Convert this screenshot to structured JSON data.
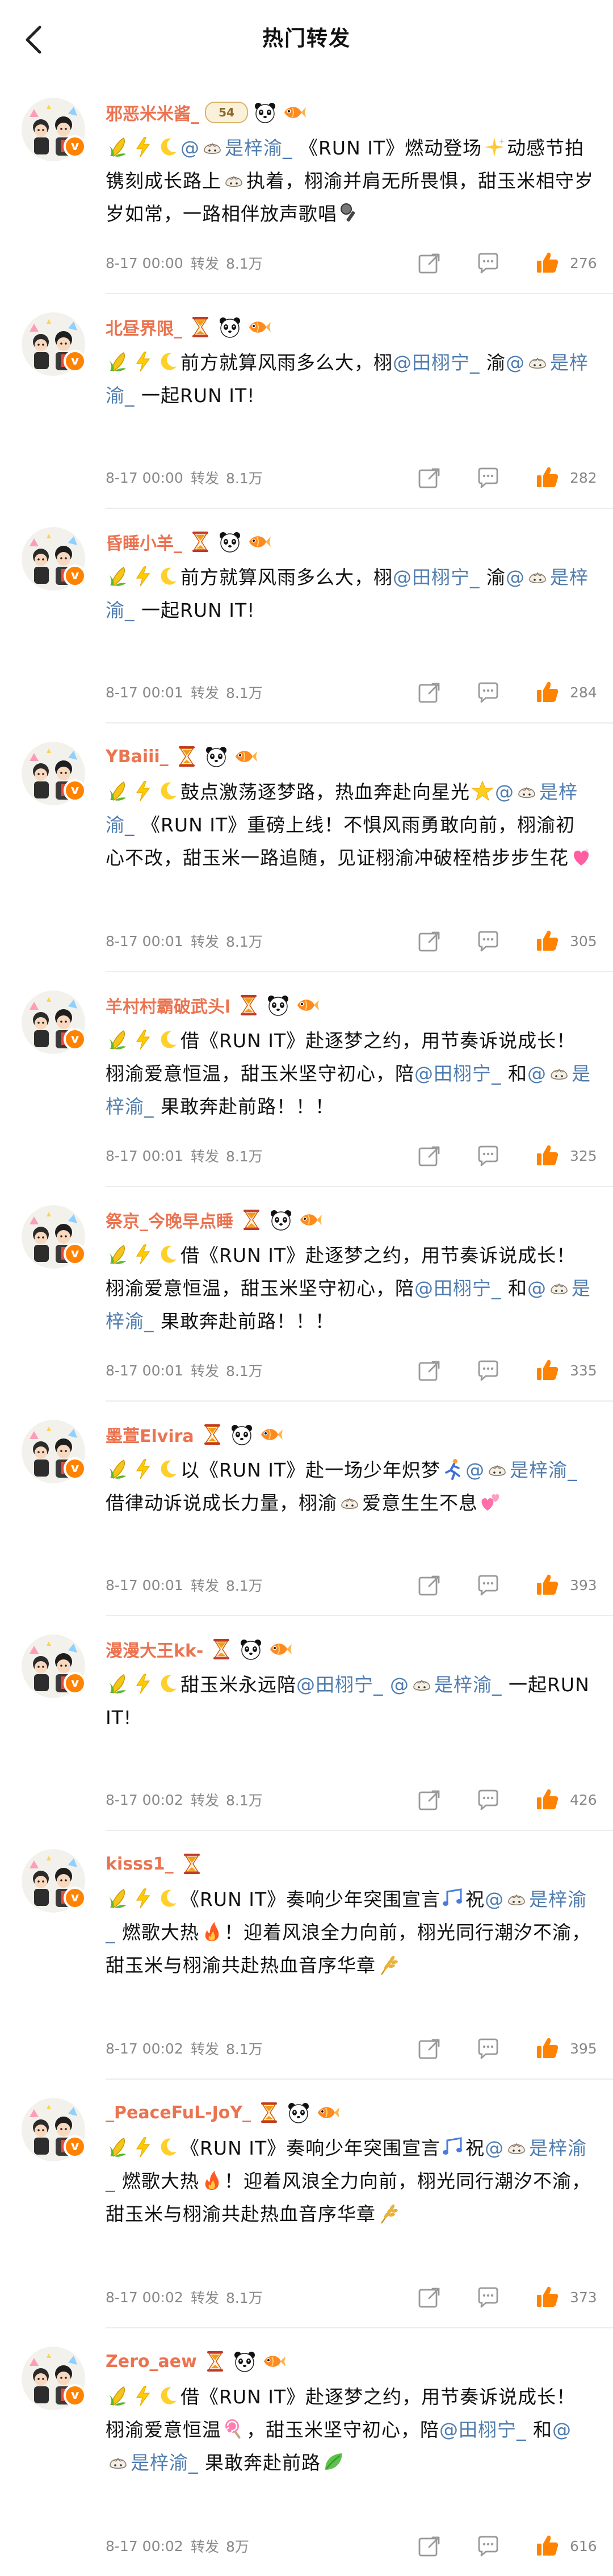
{
  "header": {
    "title": "热门转发"
  },
  "posts": [
    {
      "user": "邪恶米米酱_",
      "badge_tag": "54",
      "segments": [
        {
          "t": "emo",
          "k": "corn"
        },
        {
          "t": "emo",
          "k": "bolt"
        },
        {
          "t": "emo",
          "k": "moon"
        },
        {
          "t": "at",
          "v": "@"
        },
        {
          "t": "emo",
          "k": "dumpling"
        },
        {
          "t": "at",
          "v": "是梓渝_"
        },
        {
          "t": "text",
          "v": " 《RUN IT》燃动登场"
        },
        {
          "t": "emo",
          "k": "sparkle"
        },
        {
          "t": "text",
          "v": "动感节拍镌刻成长路上"
        },
        {
          "t": "emo",
          "k": "dumpling"
        },
        {
          "t": "text",
          "v": "执着，栩渝并肩无所畏惧，甜玉米相守岁岁如常，一路相伴放声歌唱"
        },
        {
          "t": "emo",
          "k": "mic"
        }
      ],
      "time": "8-17 00:00",
      "repost_label": "转发",
      "repost_count": "8.1万",
      "likes": "276"
    },
    {
      "user": "北昼界限_",
      "segments": [
        {
          "t": "emo",
          "k": "corn"
        },
        {
          "t": "emo",
          "k": "bolt"
        },
        {
          "t": "emo",
          "k": "moon"
        },
        {
          "t": "text",
          "v": "前方就算风雨多么大，栩"
        },
        {
          "t": "at",
          "v": "@田栩宁_"
        },
        {
          "t": "text",
          "v": " 渝"
        },
        {
          "t": "at",
          "v": "@"
        },
        {
          "t": "emo",
          "k": "dumpling"
        },
        {
          "t": "at",
          "v": "是梓渝_"
        },
        {
          "t": "text",
          "v": " 一起RUN IT!"
        }
      ],
      "time": "8-17 00:00",
      "repost_label": "转发",
      "repost_count": "8.1万",
      "likes": "282"
    },
    {
      "user": "昏睡小羊_",
      "segments": [
        {
          "t": "emo",
          "k": "corn"
        },
        {
          "t": "emo",
          "k": "bolt"
        },
        {
          "t": "emo",
          "k": "moon"
        },
        {
          "t": "text",
          "v": "前方就算风雨多么大，栩"
        },
        {
          "t": "at",
          "v": "@田栩宁_"
        },
        {
          "t": "text",
          "v": " 渝"
        },
        {
          "t": "at",
          "v": "@"
        },
        {
          "t": "emo",
          "k": "dumpling"
        },
        {
          "t": "at",
          "v": "是梓渝_"
        },
        {
          "t": "text",
          "v": " 一起RUN IT!"
        }
      ],
      "time": "8-17 00:01",
      "repost_label": "转发",
      "repost_count": "8.1万",
      "likes": "284"
    },
    {
      "user": "YBaiii_",
      "segments": [
        {
          "t": "emo",
          "k": "corn"
        },
        {
          "t": "emo",
          "k": "bolt"
        },
        {
          "t": "emo",
          "k": "moon"
        },
        {
          "t": "text",
          "v": "鼓点激荡逐梦路，热血奔赴向星光"
        },
        {
          "t": "emo",
          "k": "star"
        },
        {
          "t": "at",
          "v": "@"
        },
        {
          "t": "emo",
          "k": "dumpling"
        },
        {
          "t": "at",
          "v": "是梓渝_"
        },
        {
          "t": "text",
          "v": " 《RUN IT》重磅上线！不惧风雨勇敢向前，栩渝初心不改，甜玉米一路追随，见证栩渝冲破桎梏步步生花"
        },
        {
          "t": "emo",
          "k": "heart"
        }
      ],
      "time": "8-17 00:01",
      "repost_label": "转发",
      "repost_count": "8.1万",
      "likes": "305"
    },
    {
      "user": "羊村村霸破武头l",
      "segments": [
        {
          "t": "emo",
          "k": "corn"
        },
        {
          "t": "emo",
          "k": "bolt"
        },
        {
          "t": "emo",
          "k": "moon"
        },
        {
          "t": "text",
          "v": "借《RUN IT》赴逐梦之约，用节奏诉说成长！栩渝爱意恒温，甜玉米坚守初心，陪"
        },
        {
          "t": "at",
          "v": "@田栩宁_"
        },
        {
          "t": "text",
          "v": " 和"
        },
        {
          "t": "at",
          "v": "@"
        },
        {
          "t": "emo",
          "k": "dumpling"
        },
        {
          "t": "at",
          "v": "是梓渝_"
        },
        {
          "t": "text",
          "v": " 果敢奔赴前路！！！"
        }
      ],
      "time": "8-17 00:01",
      "repost_label": "转发",
      "repost_count": "8.1万",
      "likes": "325"
    },
    {
      "user": "祭京_今晚早点睡",
      "segments": [
        {
          "t": "emo",
          "k": "corn"
        },
        {
          "t": "emo",
          "k": "bolt"
        },
        {
          "t": "emo",
          "k": "moon"
        },
        {
          "t": "text",
          "v": "借《RUN IT》赴逐梦之约，用节奏诉说成长！栩渝爱意恒温，甜玉米坚守初心，陪"
        },
        {
          "t": "at",
          "v": "@田栩宁_"
        },
        {
          "t": "text",
          "v": " 和"
        },
        {
          "t": "at",
          "v": "@"
        },
        {
          "t": "emo",
          "k": "dumpling"
        },
        {
          "t": "at",
          "v": "是梓渝_"
        },
        {
          "t": "text",
          "v": " 果敢奔赴前路！！！"
        }
      ],
      "time": "8-17 00:01",
      "repost_label": "转发",
      "repost_count": "8.1万",
      "likes": "335"
    },
    {
      "user": "墨萱Elvira",
      "segments": [
        {
          "t": "emo",
          "k": "corn"
        },
        {
          "t": "emo",
          "k": "bolt"
        },
        {
          "t": "emo",
          "k": "moon"
        },
        {
          "t": "text",
          "v": "以《RUN IT》赴一场少年炽梦"
        },
        {
          "t": "emo",
          "k": "runner"
        },
        {
          "t": "at",
          "v": "@"
        },
        {
          "t": "emo",
          "k": "dumpling"
        },
        {
          "t": "at",
          "v": "是梓渝_"
        },
        {
          "t": "text",
          "v": " 借律动诉说成长力量，栩渝"
        },
        {
          "t": "emo",
          "k": "dumpling"
        },
        {
          "t": "text",
          "v": "爱意生生不息"
        },
        {
          "t": "emo",
          "k": "hearts"
        }
      ],
      "time": "8-17 00:01",
      "repost_label": "转发",
      "repost_count": "8.1万",
      "likes": "393"
    },
    {
      "user": "漫漫大王kk-",
      "segments": [
        {
          "t": "emo",
          "k": "corn"
        },
        {
          "t": "emo",
          "k": "bolt"
        },
        {
          "t": "emo",
          "k": "moon"
        },
        {
          "t": "text",
          "v": "甜玉米永远陪"
        },
        {
          "t": "at",
          "v": "@田栩宁_"
        },
        {
          "t": "text",
          "v": " "
        },
        {
          "t": "at",
          "v": "@"
        },
        {
          "t": "emo",
          "k": "dumpling"
        },
        {
          "t": "at",
          "v": "是梓渝_"
        },
        {
          "t": "text",
          "v": " 一起RUN IT!"
        }
      ],
      "time": "8-17 00:02",
      "repost_label": "转发",
      "repost_count": "8.1万",
      "likes": "426"
    },
    {
      "user": "kisss1_",
      "segments": [
        {
          "t": "emo",
          "k": "corn"
        },
        {
          "t": "emo",
          "k": "bolt"
        },
        {
          "t": "emo",
          "k": "moon"
        },
        {
          "t": "text",
          "v": "《RUN IT》奏响少年突围宣言"
        },
        {
          "t": "emo",
          "k": "notes"
        },
        {
          "t": "text",
          "v": "祝"
        },
        {
          "t": "at",
          "v": "@"
        },
        {
          "t": "emo",
          "k": "dumpling"
        },
        {
          "t": "at",
          "v": "是梓渝_"
        },
        {
          "t": "text",
          "v": " 燃歌大热"
        },
        {
          "t": "emo",
          "k": "fire"
        },
        {
          "t": "text",
          "v": "！迎着风浪全力向前，栩光同行潮汐不渝，甜玉米与栩渝共赴热血音序华章"
        },
        {
          "t": "emo",
          "k": "wheat"
        }
      ],
      "time": "8-17 00:02",
      "repost_label": "转发",
      "repost_count": "8.1万",
      "likes": "395"
    },
    {
      "user": "_PeaceFuL-JoY_",
      "segments": [
        {
          "t": "emo",
          "k": "corn"
        },
        {
          "t": "emo",
          "k": "bolt"
        },
        {
          "t": "emo",
          "k": "moon"
        },
        {
          "t": "text",
          "v": "《RUN IT》奏响少年突围宣言"
        },
        {
          "t": "emo",
          "k": "notes"
        },
        {
          "t": "text",
          "v": "祝"
        },
        {
          "t": "at",
          "v": "@"
        },
        {
          "t": "emo",
          "k": "dumpling"
        },
        {
          "t": "at",
          "v": "是梓渝_"
        },
        {
          "t": "text",
          "v": " 燃歌大热"
        },
        {
          "t": "emo",
          "k": "fire"
        },
        {
          "t": "text",
          "v": "！迎着风浪全力向前，栩光同行潮汐不渝，甜玉米与栩渝共赴热血音序华章"
        },
        {
          "t": "emo",
          "k": "wheat"
        }
      ],
      "time": "8-17 00:02",
      "repost_label": "转发",
      "repost_count": "8.1万",
      "likes": "373"
    },
    {
      "user": "Zero_aew",
      "segments": [
        {
          "t": "emo",
          "k": "corn"
        },
        {
          "t": "emo",
          "k": "bolt"
        },
        {
          "t": "emo",
          "k": "moon"
        },
        {
          "t": "text",
          "v": "借《RUN IT》赴逐梦之约，用节奏诉说成长！栩渝爱意恒温"
        },
        {
          "t": "emo",
          "k": "lollipop"
        },
        {
          "t": "text",
          "v": "，甜玉米坚守初心，陪"
        },
        {
          "t": "at",
          "v": "@田栩宁_"
        },
        {
          "t": "text",
          "v": " 和"
        },
        {
          "t": "at",
          "v": "@"
        },
        {
          "t": "emo",
          "k": "dumpling"
        },
        {
          "t": "at",
          "v": "是梓渝_"
        },
        {
          "t": "text",
          "v": " 果敢奔赴前路"
        },
        {
          "t": "emo",
          "k": "leaf"
        }
      ],
      "time": "8-17 00:02",
      "repost_label": "转发",
      "repost_count": "8万",
      "likes": "616"
    }
  ],
  "colors": {
    "username": "#eb7350",
    "mention": "#507daf",
    "like_icon": "#ff8200",
    "meta": "#888888"
  }
}
